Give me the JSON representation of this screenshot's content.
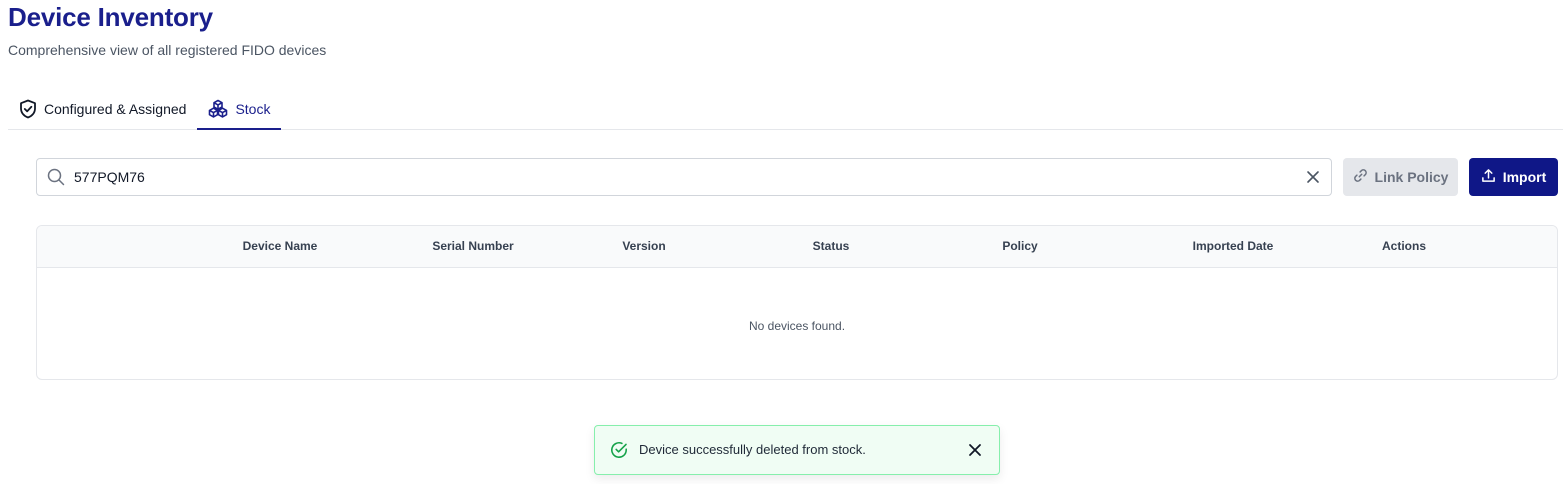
{
  "header": {
    "title": "Device Inventory",
    "subtitle": "Comprehensive view of all registered FIDO devices"
  },
  "tabs": [
    {
      "label": "Configured & Assigned",
      "icon": "shield-check-icon",
      "active": false
    },
    {
      "label": "Stock",
      "icon": "boxes-icon",
      "active": true
    }
  ],
  "search": {
    "value": "577PQM76",
    "placeholder": ""
  },
  "toolbar": {
    "link_policy_label": "Link Policy",
    "import_label": "Import"
  },
  "table": {
    "columns": [
      "",
      "Device Name",
      "Serial Number",
      "Version",
      "Status",
      "Policy",
      "Imported Date",
      "Actions"
    ],
    "rows": [],
    "empty_message": "No devices found."
  },
  "toast": {
    "message": "Device successfully deleted from stock.",
    "type": "success"
  },
  "colors": {
    "brand": "#1a1f8c",
    "primary_button": "#0f1787",
    "disabled_button": "#e5e7eb",
    "success_bg": "#f0fdf4",
    "success_border": "#86efac",
    "success_icon": "#16a34a"
  }
}
